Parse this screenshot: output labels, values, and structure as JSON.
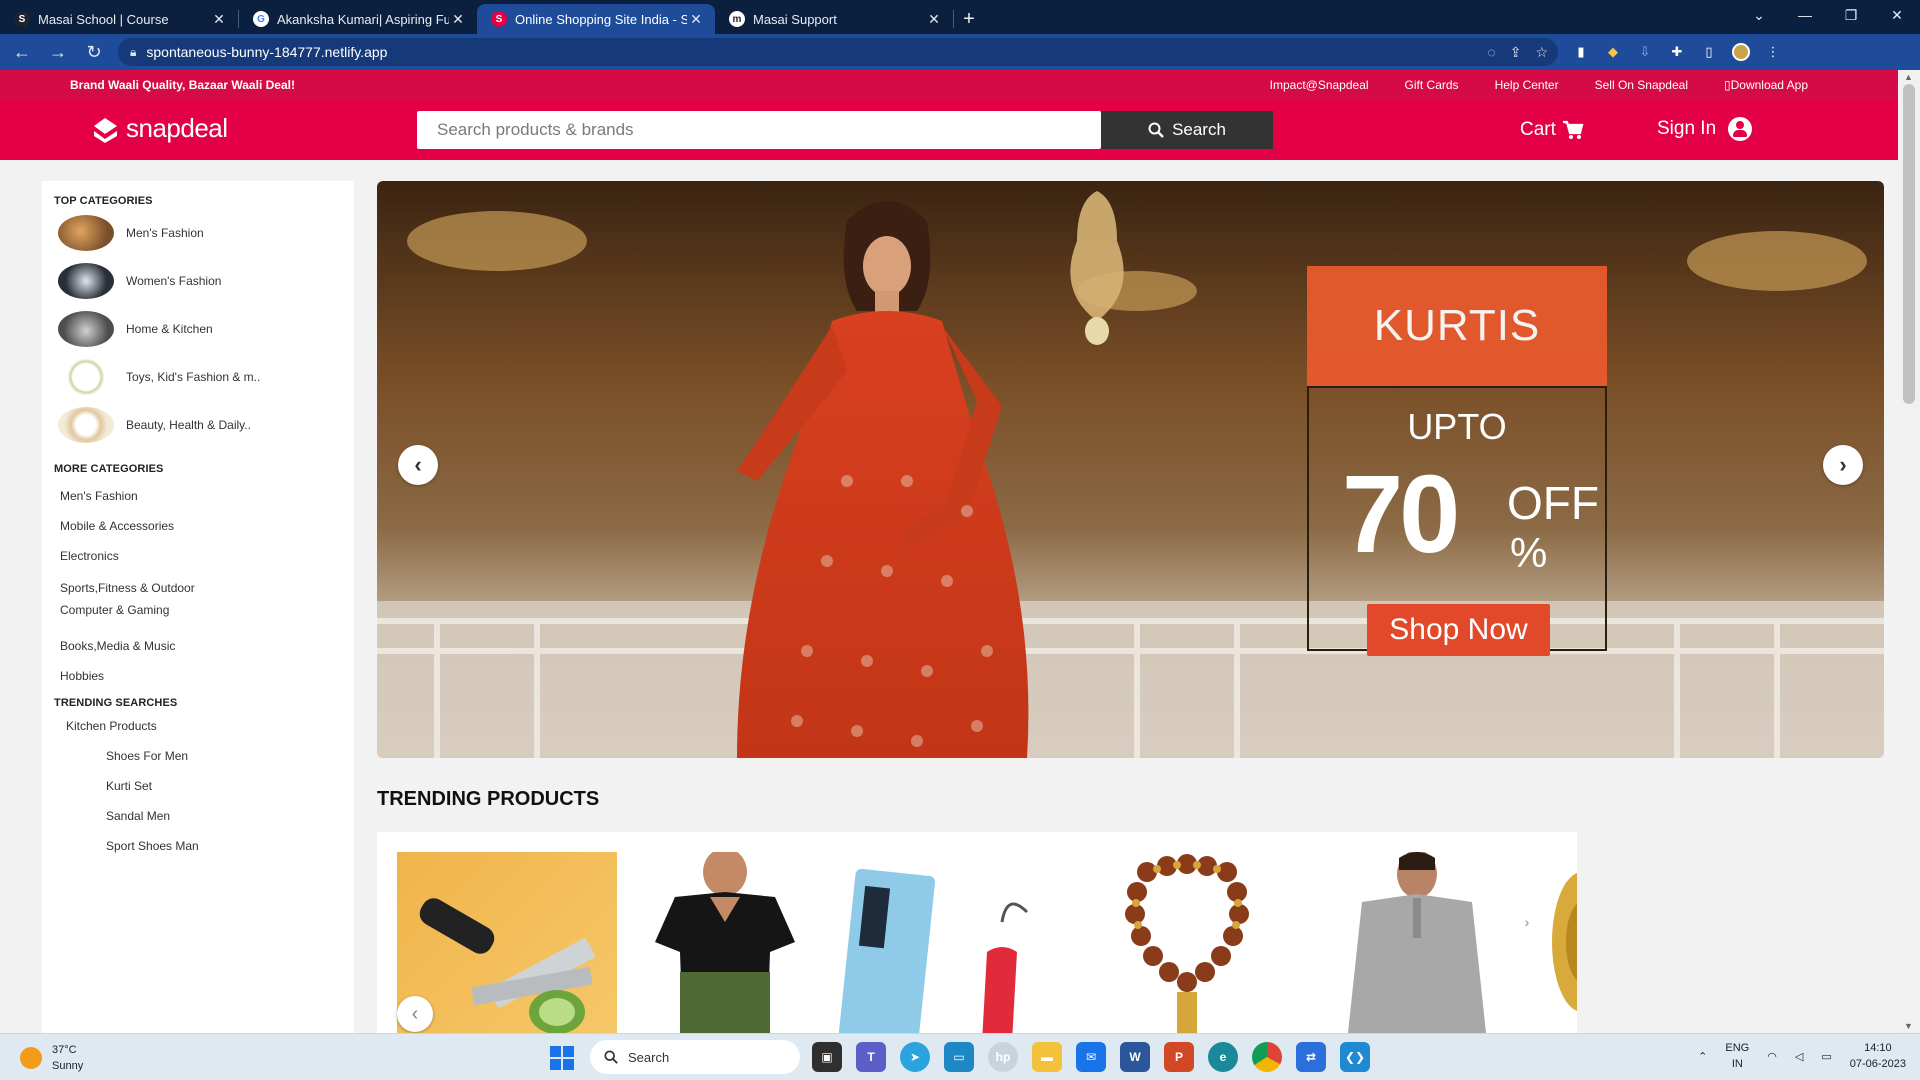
{
  "browser": {
    "tabs": [
      {
        "title": "Masai School | Course",
        "favicon_color": "#1c2430",
        "favicon_glyph": "S"
      },
      {
        "title": "Akanksha Kumari| Aspiring Full St",
        "favicon_color": "#ffffff",
        "favicon_glyph": "G"
      },
      {
        "title": "Online Shopping Site India - Sho",
        "favicon_color": "#e40046",
        "favicon_glyph": "S"
      },
      {
        "title": "Masai Support",
        "favicon_color": "#ffffff",
        "favicon_glyph": "m"
      }
    ],
    "active_tab": 2,
    "url": "spontaneous-bunny-184777.netlify.app"
  },
  "header": {
    "promo": "Brand Waali Quality, Bazaar Waali Deal!",
    "top_links": [
      "Impact@Snapdeal",
      "Gift Cards",
      "Help Center",
      "Sell On Snapdeal",
      "Download App"
    ],
    "logo": "snapdeal",
    "search_placeholder": "Search products & brands",
    "search_button": "Search",
    "cart": "Cart",
    "signin": "Sign In"
  },
  "sidebar": {
    "top_title": "TOP CATEGORIES",
    "top_categories": [
      {
        "label": "Men's Fashion",
        "color": "#b9864a"
      },
      {
        "label": "Women's Fashion",
        "color": "#3c4150"
      },
      {
        "label": "Home & Kitchen",
        "color": "#6a6a6a"
      },
      {
        "label": "Toys, Kid's Fashion & m..",
        "color": "#d9e4c6"
      },
      {
        "label": "Beauty, Health & Daily..",
        "color": "#e9d7b8"
      }
    ],
    "more_title": "MORE CATEGORIES",
    "more_categories": [
      "Men's Fashion",
      "Mobile & Accessories",
      "Electronics",
      "Sports,Fitness & Outdoor",
      "Computer & Gaming",
      "Books,Media & Music",
      "Hobbies"
    ],
    "trending_title": "TRENDING SEARCHES",
    "trending": [
      "Kitchen Products",
      "Shoes For Men",
      "Kurti Set",
      "Sandal Men",
      "Sport Shoes Man"
    ]
  },
  "banner": {
    "headline": "KURTIS",
    "upto": "UPTO",
    "discount": "70",
    "off": "OFF",
    "percent": "%",
    "cta": "Shop Now"
  },
  "trending_products": {
    "title": "TRENDING PRODUCTS"
  },
  "taskbar": {
    "temp": "37°C",
    "condition": "Sunny",
    "search": "Search",
    "lang_1": "ENG",
    "lang_2": "IN",
    "time": "14:10",
    "date": "07-06-2023"
  }
}
